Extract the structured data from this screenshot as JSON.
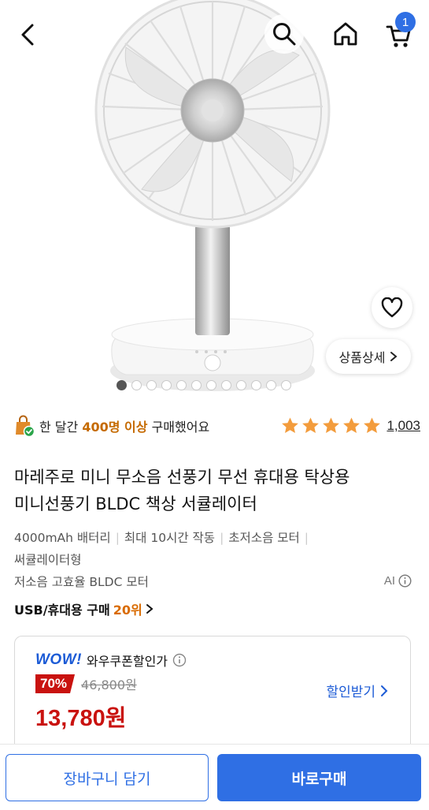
{
  "header": {
    "cart_count": "1"
  },
  "gallery": {
    "detail_label": "상품상세",
    "slide_count": 12,
    "active_slide": 1
  },
  "social_proof": {
    "prefix": "한 달간",
    "highlight": "400명 이상",
    "suffix": "구매했어요",
    "rating_stars": 5,
    "review_count": "1,003"
  },
  "product": {
    "title_line1": "마레주로 미니 무소음 선풍기 무선 휴대용 탁상용",
    "title_line2": "미니선풍기 BLDC 책상 서큘레이터",
    "attributes": [
      "4000mAh 배터리",
      "최대 10시간 작동",
      "초저소음 모터",
      "써큘레이터형"
    ],
    "sub_feature": "저소음 고효율 BLDC 모터",
    "ai_label": "AI",
    "rank_category": "USB/휴대용 구매",
    "rank_value": "20위"
  },
  "coupon": {
    "wow_logo": "WOW!",
    "wow_text": "와우쿠폰할인가",
    "discount": "70%",
    "original_price": "46,800원",
    "sale_price": "13,780원",
    "get_coupon_label": "할인받기"
  },
  "bottom": {
    "cart_label": "장바구니 담기",
    "buy_label": "바로구매"
  },
  "colors": {
    "accent_blue": "#2f6fe4",
    "price_red": "#c9120f",
    "star_orange": "#f39c3c",
    "highlight_orange": "#c56a00"
  }
}
